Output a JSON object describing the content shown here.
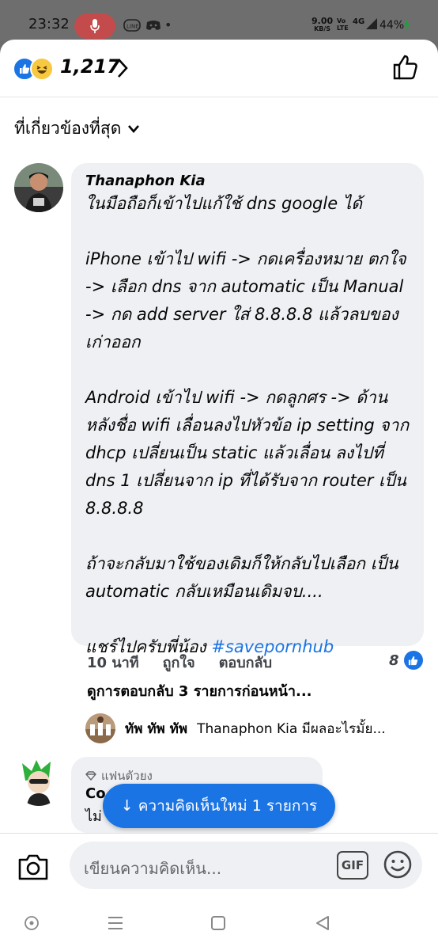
{
  "status_bar": {
    "time": "23:32",
    "speed_value": "9.00",
    "speed_unit": "KB/S",
    "network": "4G",
    "battery": "44%"
  },
  "header": {
    "reaction_count": "1,217",
    "reactions": [
      "like-icon",
      "haha-icon"
    ]
  },
  "sort": {
    "label": "ที่เกี่ยวข้องที่สุด"
  },
  "comment": {
    "author": "Thanaphon Kia",
    "text": "ในมือถือก็เข้าไปแก้ใช้ dns google ได้\n\niPhone เข้าไป wifi -> กดเครื่องหมาย ตกใจ -> เลือก dns จาก automatic เป็น Manual -> กด add server ใส่ 8.8.8.8 แล้วลบของเก่าออก\n\nAndroid เข้าไป wifi -> กดลูกศร -> ด้าน หลังชื่อ wifi เลื่อนลงไปหัวข้อ ip setting จาก dhcp เปลี่ยนเป็น static แล้วเลื่อน ลงไปที่ dns 1 เปลี่ยนจาก ip ที่ได้รับจาก router เป็น 8.8.8.8\n\nถ้าจะกลับมาใช้ของเดิมก็ให้กลับไปเลือก เป็น automatic กลับเหมือนเดิมจบ....\n\nแชร์ไปครับพี่น้อง ",
    "hashtag": "#savepornhub",
    "time": "10 นาที",
    "like_label": "ถูกใจ",
    "reply_label": "ตอบกลับ",
    "like_count": "8",
    "prev_replies": "ดูการตอบกลับ 3 รายการก่อนหน้า...",
    "reply_preview": {
      "author": "ทัพ ทัพ ทัพ",
      "text": "Thanaphon Kia มีผลอะไรมั้ย..."
    }
  },
  "comment2": {
    "badge": "แฟนตัวยง",
    "author": "Co",
    "text": "ไม่"
  },
  "new_comments_pill": "↓ ความคิดเห็นใหม่ 1 รายการ",
  "composer": {
    "placeholder": "เขียนความคิดเห็น...",
    "gif_label": "GIF"
  },
  "colors": {
    "accent": "#1b74e4",
    "bubble": "#eef0f3",
    "text": "#050505",
    "muted": "#65676b"
  }
}
